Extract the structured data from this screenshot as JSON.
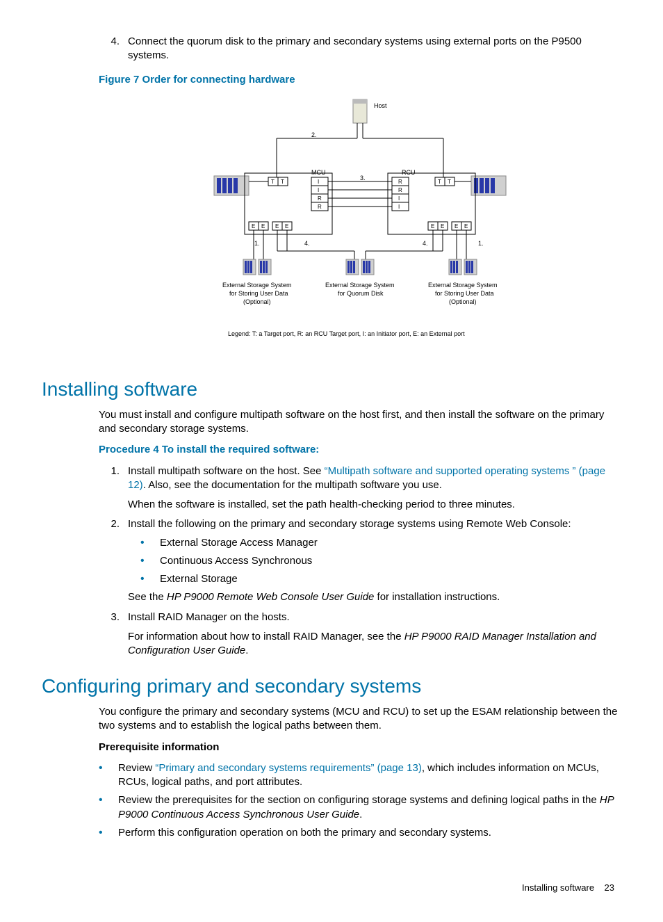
{
  "step4": {
    "num": "4.",
    "text": "Connect the quorum disk to the primary and secondary systems using external ports on the P9500 systems."
  },
  "figure7": {
    "caption": "Figure 7 Order for connecting hardware",
    "labels": {
      "host": "Host",
      "mcu": "MCU",
      "rcu": "RCU",
      "ext_left": "External Storage System for Storing User Data (Optional)",
      "ext_mid": "External Storage System for Quorum Disk",
      "ext_right": "External Storage System for Storing User Data (Optional)",
      "n1": "1.",
      "n2": "2.",
      "n3": "3.",
      "n4": "4.",
      "T": "T",
      "I": "I",
      "R": "R",
      "E": "E"
    },
    "legend": "Legend: T: a Target port,  R: an RCU Target port,  I: an Initiator port,  E: an External port"
  },
  "h_install": "Installing software",
  "install_intro": "You must install and configure multipath software on the host first, and then install the software on the primary and secondary storage systems.",
  "proc4_title": "Procedure 4 To install the required software:",
  "proc4": {
    "s1": {
      "num": "1.",
      "pre": "Install multipath software on the host. See ",
      "link": "“Multipath software and supported operating systems ” (page 12)",
      "post": ". Also, see the documentation for the multipath software you use.",
      "sub": "When the software is installed, set the path health-checking period to three minutes."
    },
    "s2": {
      "num": "2.",
      "text": "Install the following on the primary and secondary storage systems using Remote Web Console:",
      "b1": "External Storage Access Manager",
      "b2": "Continuous Access Synchronous",
      "b3": "External Storage",
      "see_pre": "See the ",
      "see_em": "HP P9000 Remote Web Console User Guide",
      "see_post": " for installation instructions."
    },
    "s3": {
      "num": "3.",
      "text": "Install RAID Manager on the hosts.",
      "sub_pre": "For information about how to install RAID Manager, see the ",
      "sub_em": "HP P9000 RAID Manager Installation and Configuration User Guide",
      "sub_post": "."
    }
  },
  "h_config": "Configuring primary and secondary systems",
  "config_intro": "You configure the primary and secondary systems (MCU and RCU) to set up the ESAM relationship between the two systems and to establish the logical paths between them.",
  "prereq_title": "Prerequisite information",
  "prereq": {
    "b1_pre": "Review ",
    "b1_link": "“Primary and secondary systems requirements” (page 13)",
    "b1_post": ", which includes information on MCUs, RCUs, logical paths, and port attributes.",
    "b2_pre": "Review the prerequisites for the section on configuring storage systems and defining logical paths in the ",
    "b2_em": "HP P9000 Continuous Access Synchronous User Guide",
    "b2_post": ".",
    "b3": "Perform this configuration operation on both the primary and secondary systems."
  },
  "footer": {
    "title": "Installing software",
    "page": "23"
  }
}
